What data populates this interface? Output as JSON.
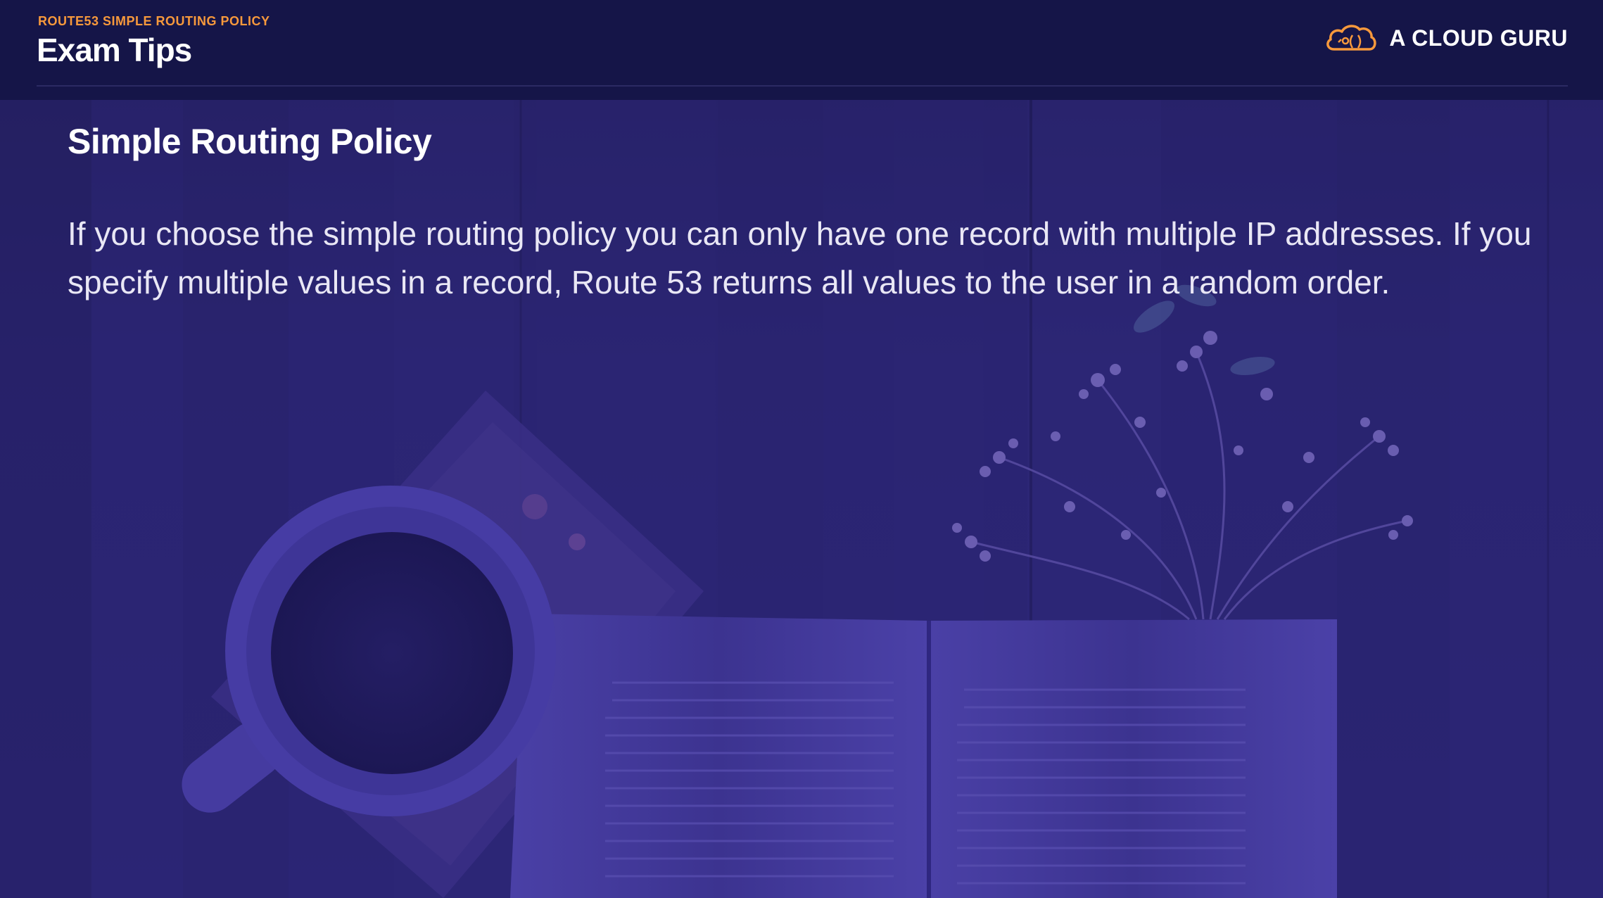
{
  "header": {
    "kicker": "ROUTE53 SIMPLE ROUTING POLICY",
    "title": "Exam Tips",
    "brand": {
      "name": "A CLOUD GURU",
      "logo_icon": "cloud-logo-icon",
      "accent_color": "#f7993c"
    }
  },
  "main": {
    "section_title": "Simple Routing Policy",
    "body": "If you choose the simple routing policy you can only have one record with multiple IP addresses. If you specify multiple values in a record, Route 53 returns all values to the user in a random order."
  },
  "background": {
    "description_icons": [
      "coffee-cup-icon",
      "open-book-icon",
      "flowers-icon"
    ]
  },
  "colors": {
    "header_bg": "#151548",
    "overlay": "#2a2472",
    "text": "#ffffff",
    "accent": "#f7993c"
  }
}
